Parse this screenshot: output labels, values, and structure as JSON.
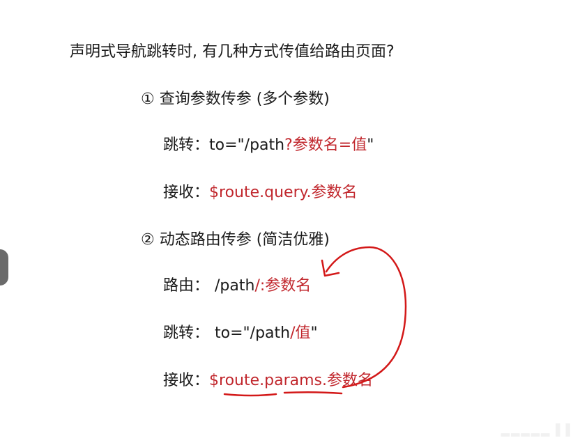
{
  "slide": {
    "title": "声明式导航跳转时, 有几种方式传值给路由页面?",
    "section1": {
      "heading": "① 查询参数传参 (多个参数)",
      "jump_label": "跳转：",
      "jump_code": "to=\"/path",
      "jump_param": "?参数名=值",
      "jump_end": "\"",
      "receive_label": "接收：",
      "receive_code": "$route.query.参数名"
    },
    "section2": {
      "heading": "② 动态路由传参 (简洁优雅)",
      "route_label": "路由：",
      "route_code": "/path",
      "route_param": "/:参数名",
      "jump_label": "跳转：",
      "jump_code": "to=\"/path",
      "jump_param": "/值",
      "jump_end": "\"",
      "receive_label": "接收：",
      "receive_prefix": "$route.",
      "receive_params": "params",
      "receive_suffix": ".参数名"
    }
  },
  "colors": {
    "accent_red": "#c1272d",
    "text": "#1a1a1a"
  }
}
